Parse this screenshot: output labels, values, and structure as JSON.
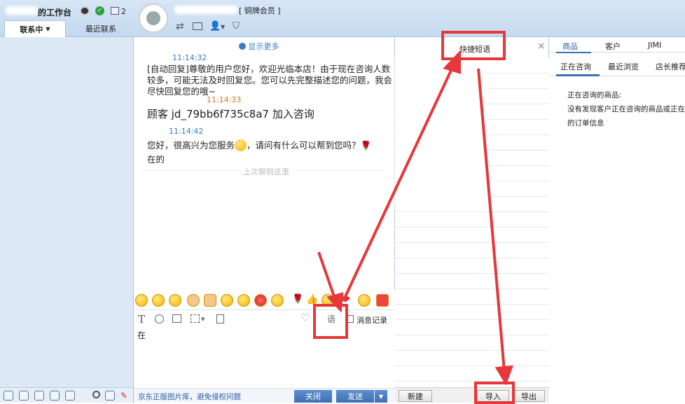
{
  "sidebar": {
    "title": "的工作台",
    "badge_count": "2",
    "tabs": [
      "联系中",
      "最近联系"
    ]
  },
  "header": {
    "member_label": "[ 铜牌会员 ]"
  },
  "chat": {
    "show_more": "显示更多",
    "messages": [
      {
        "time": "11:14:32",
        "text": "[自动回复]尊敬的用户您好，欢迎光临本店！由于现在咨询人数较多，可能无法及时回复您。您可以先完整描述您的问题，我会尽快回复您的哦~"
      },
      {
        "time": "11:14:33",
        "text": "顾客 jd_79bb6f735c8a7 加入咨询"
      },
      {
        "time": "11:14:42",
        "text": "您好，很高兴为您服务",
        "text2": "，请问有什么可以帮到您吗？",
        "text3": "在的"
      }
    ],
    "last_read": "上次聊到这里",
    "input_value": "在",
    "phrase_icon_label": "语",
    "history_label": "消息记录",
    "footer_link": "京东正版图片库，避免侵权问题",
    "close_label": "关闭",
    "send_label": "发送"
  },
  "phrases": {
    "tab_label": "快捷短语",
    "close_icon": "×",
    "new_label": "新建",
    "import_label": "导入",
    "export_label": "导出"
  },
  "right": {
    "tabs": [
      "商品",
      "客户",
      "JIMI"
    ],
    "subtabs": [
      "正在咨询",
      "最近浏览",
      "店长推荐"
    ],
    "lines": [
      "正在咨询的商品:",
      "没有发现客户正在咨询的商品或正在",
      "的订单信息"
    ]
  },
  "colors": {
    "accent": "#3e6fb5",
    "annotation": "#e8373a",
    "time_blue": "#3a7cc4",
    "time_orange": "#e2701c"
  }
}
